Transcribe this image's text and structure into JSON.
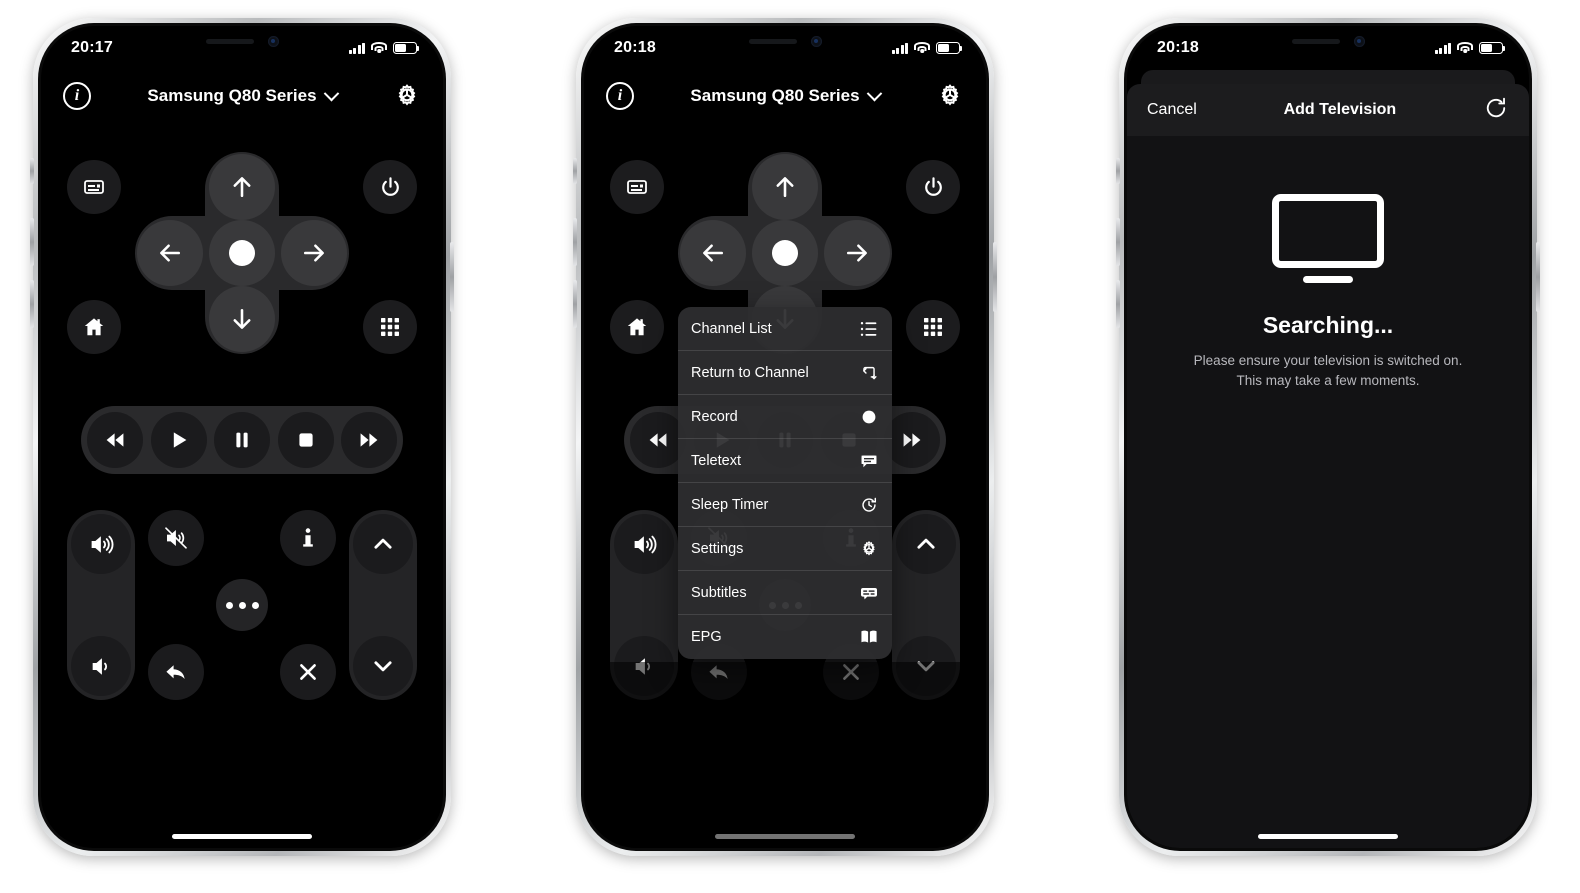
{
  "phones": {
    "one": {
      "status": {
        "time": "20:17",
        "signal_icon": "cellular-signal-icon",
        "wifi_icon": "wifi-icon",
        "battery_icon": "battery-icon"
      },
      "navbar": {
        "info_icon": "info-circle-icon",
        "title": "Samsung Q80 Series",
        "chevron_icon": "chevron-down-icon",
        "settings_icon": "gear-icon"
      }
    },
    "two": {
      "status": {
        "time": "20:18"
      },
      "navbar": {
        "title": "Samsung Q80 Series"
      }
    },
    "three": {
      "status": {
        "time": "20:18"
      },
      "sheet": {
        "cancel_label": "Cancel",
        "title": "Add Television",
        "refresh_icon": "refresh-icon",
        "tv_icon": "television-icon",
        "heading": "Searching...",
        "subtext_line1": "Please ensure your television is switched on.",
        "subtext_line2": "This may take a few moments."
      }
    }
  },
  "remote": {
    "buttons": {
      "source": {
        "name": "source-icon",
        "label": "Source"
      },
      "power": {
        "name": "power-icon",
        "label": "Power"
      },
      "home": {
        "name": "home-icon",
        "label": "Home"
      },
      "keypad": {
        "name": "keypad-grid-icon",
        "label": "Keypad"
      },
      "up": {
        "name": "arrow-up-icon",
        "label": "Up"
      },
      "down": {
        "name": "arrow-down-icon",
        "label": "Down"
      },
      "left": {
        "name": "arrow-left-icon",
        "label": "Left"
      },
      "right": {
        "name": "arrow-right-icon",
        "label": "Right"
      },
      "ok": {
        "name": "ok-center-icon",
        "label": "OK"
      },
      "rewind": {
        "name": "rewind-icon",
        "label": "Rewind"
      },
      "play": {
        "name": "play-icon",
        "label": "Play"
      },
      "pause": {
        "name": "pause-icon",
        "label": "Pause"
      },
      "stop": {
        "name": "stop-icon",
        "label": "Stop"
      },
      "fastforward": {
        "name": "fast-forward-icon",
        "label": "Fast Forward"
      },
      "volume_up": {
        "name": "volume-up-icon",
        "label": "Volume Up"
      },
      "volume_down": {
        "name": "volume-down-icon",
        "label": "Volume Down"
      },
      "mute": {
        "name": "mute-icon",
        "label": "Mute"
      },
      "info": {
        "name": "info-icon",
        "label": "Info"
      },
      "more": {
        "name": "more-dots-icon",
        "label": "More"
      },
      "back": {
        "name": "back-arrow-icon",
        "label": "Back"
      },
      "exit": {
        "name": "close-x-icon",
        "label": "Exit"
      },
      "channel_up": {
        "name": "chevron-up-icon",
        "label": "Channel Up"
      },
      "channel_down": {
        "name": "chevron-down-icon",
        "label": "Channel Down"
      }
    }
  },
  "context_menu": {
    "items": [
      {
        "label": "Channel List",
        "icon": "list-icon"
      },
      {
        "label": "Return to Channel",
        "icon": "return-loop-icon"
      },
      {
        "label": "Record",
        "icon": "record-dot-icon"
      },
      {
        "label": "Teletext",
        "icon": "teletext-icon"
      },
      {
        "label": "Sleep Timer",
        "icon": "sleep-timer-icon"
      },
      {
        "label": "Settings",
        "icon": "gear-icon"
      },
      {
        "label": "Subtitles",
        "icon": "subtitles-icon"
      },
      {
        "label": "EPG",
        "icon": "epg-book-icon"
      }
    ]
  },
  "colors": {
    "screen_bg": "#000000",
    "button_fill": "#1b1b1d",
    "pill_fill": "#2a2a2c",
    "dkey_fill": "#39393b",
    "menu_fill": "#2e2e30",
    "text_primary": "#ffffff",
    "text_secondary": "#b8b8bd"
  }
}
